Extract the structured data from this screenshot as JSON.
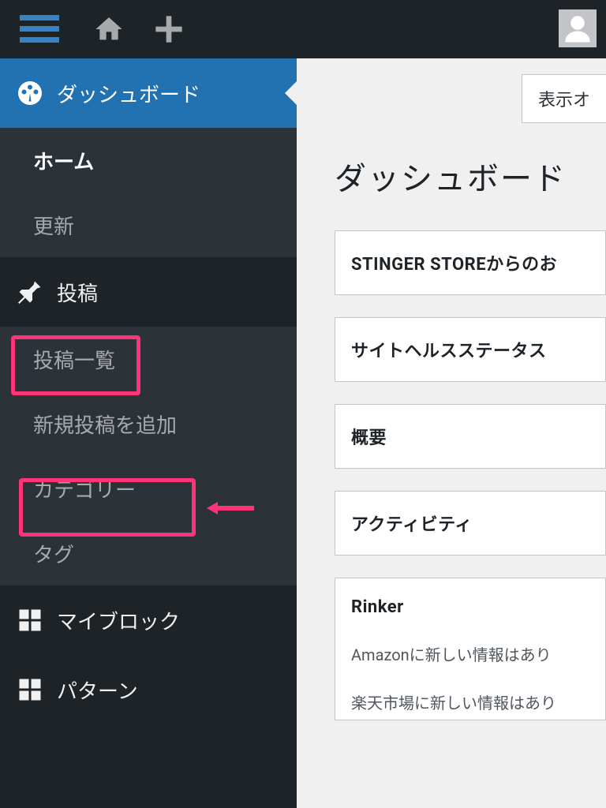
{
  "topbar": {
    "screen_options": "表示オ"
  },
  "sidebar": {
    "dashboard": "ダッシュボード",
    "home": "ホーム",
    "updates": "更新",
    "posts": "投稿",
    "posts_sub": {
      "all": "投稿一覧",
      "new": "新規投稿を追加",
      "categories": "カテゴリー",
      "tags": "タグ"
    },
    "myblock": "マイブロック",
    "pattern": "パターン"
  },
  "content": {
    "title": "ダッシュボード",
    "widgets": {
      "stinger": "STINGER STOREからのお",
      "health": "サイトヘルスステータス",
      "overview": "概要",
      "activity": "アクティビティ",
      "rinker_title": "Rinker",
      "rinker_amazon": "Amazonに新しい情報はあり",
      "rinker_rakuten": "楽天市場に新しい情報はあり"
    }
  }
}
